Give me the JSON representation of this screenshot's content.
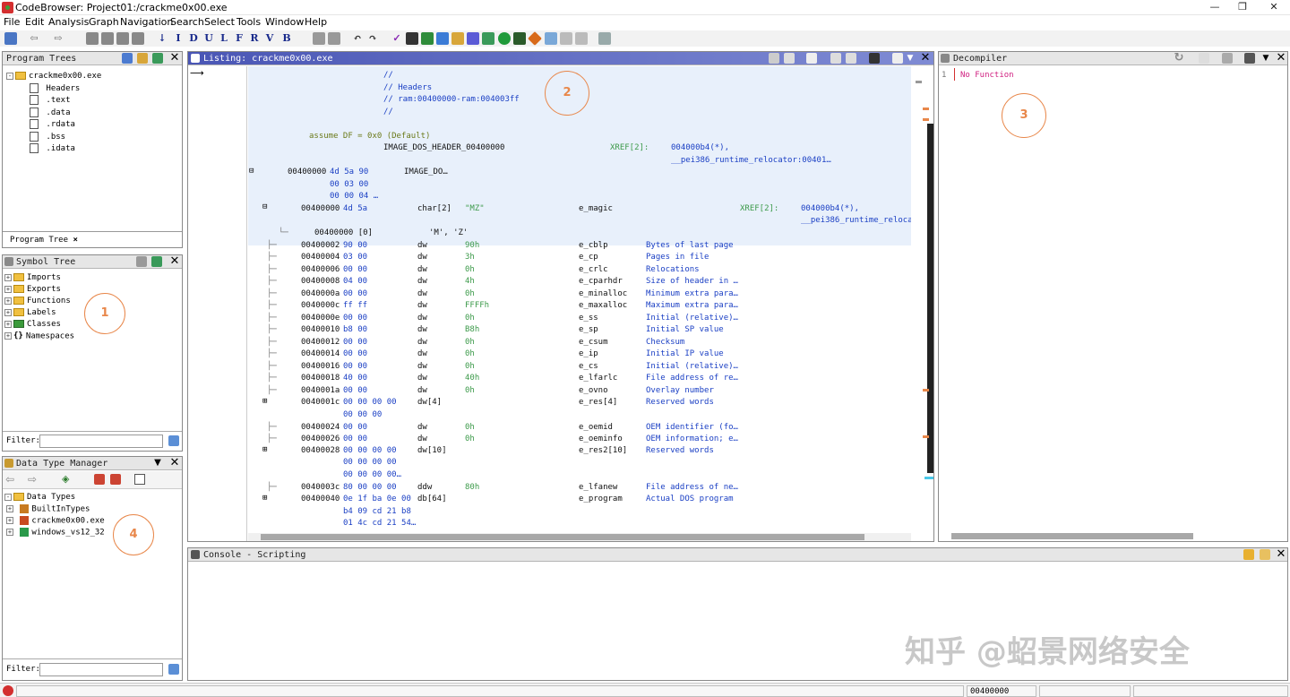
{
  "window": {
    "title": "CodeBrowser: Project01:/crackme0x00.exe"
  },
  "menu": [
    "File",
    "Edit",
    "Analysis",
    "Graph",
    "Navigation",
    "Search",
    "Select",
    "Tools",
    "Window",
    "Help"
  ],
  "program_trees": {
    "title": "Program Trees",
    "root": "crackme0x00.exe",
    "items": [
      "Headers",
      ".text",
      ".data",
      ".rdata",
      ".bss",
      ".idata"
    ],
    "tab": "Program Tree"
  },
  "symbol_tree": {
    "title": "Symbol Tree",
    "items": [
      "Imports",
      "Exports",
      "Functions",
      "Labels",
      "Classes",
      "Namespaces"
    ],
    "filter_label": "Filter:"
  },
  "dtm": {
    "title": "Data Type Manager",
    "root": "Data Types",
    "items": [
      "BuiltInTypes",
      "crackme0x00.exe",
      "windows_vs12_32"
    ],
    "filter_label": "Filter:"
  },
  "listing": {
    "title": "Listing:  crackme0x00.exe",
    "comments": [
      "//",
      "// Headers",
      "// ram:00400000-ram:004003ff",
      "//"
    ],
    "assume": "assume DF = 0x0  (Default)",
    "header_label": "IMAGE_DOS_HEADER_00400000",
    "header_xref_label": "XREF[2]:",
    "header_xref1": "004000b4(*),",
    "header_xref2": "__pei386_runtime_relocator:00401…",
    "struct_addr": "00400000",
    "struct_bytes": "4d 5a 90",
    "struct_bytes2": "00 03 00",
    "struct_bytes3": "00 00 04 …",
    "struct_name": "IMAGE_DO…",
    "magic": {
      "addr": "00400000",
      "bytes": "4d 5a",
      "type": "char[2]",
      "val": "\"MZ\"",
      "field": "e_magic",
      "xref_label": "XREF[2]:",
      "xref1": "004000b4(*),",
      "xref2": "__pei386_runtime_relocat"
    },
    "magic_sub": {
      "addr": "00400000 [0]",
      "val": "'M', 'Z'"
    },
    "rows": [
      {
        "addr": "00400002",
        "bytes": "90 00",
        "mn": "dw",
        "val": "90h",
        "field": "e_cblp",
        "cmt": "Bytes of last page"
      },
      {
        "addr": "00400004",
        "bytes": "03 00",
        "mn": "dw",
        "val": "3h",
        "field": "e_cp",
        "cmt": "Pages in file"
      },
      {
        "addr": "00400006",
        "bytes": "00 00",
        "mn": "dw",
        "val": "0h",
        "field": "e_crlc",
        "cmt": "Relocations"
      },
      {
        "addr": "00400008",
        "bytes": "04 00",
        "mn": "dw",
        "val": "4h",
        "field": "e_cparhdr",
        "cmt": "Size of header in …"
      },
      {
        "addr": "0040000a",
        "bytes": "00 00",
        "mn": "dw",
        "val": "0h",
        "field": "e_minalloc",
        "cmt": "Minimum extra para…"
      },
      {
        "addr": "0040000c",
        "bytes": "ff ff",
        "mn": "dw",
        "val": "FFFFh",
        "field": "e_maxalloc",
        "cmt": "Maximum extra para…"
      },
      {
        "addr": "0040000e",
        "bytes": "00 00",
        "mn": "dw",
        "val": "0h",
        "field": "e_ss",
        "cmt": "Initial (relative)…"
      },
      {
        "addr": "00400010",
        "bytes": "b8 00",
        "mn": "dw",
        "val": "B8h",
        "field": "e_sp",
        "cmt": "Initial SP value"
      },
      {
        "addr": "00400012",
        "bytes": "00 00",
        "mn": "dw",
        "val": "0h",
        "field": "e_csum",
        "cmt": "Checksum"
      },
      {
        "addr": "00400014",
        "bytes": "00 00",
        "mn": "dw",
        "val": "0h",
        "field": "e_ip",
        "cmt": "Initial IP value"
      },
      {
        "addr": "00400016",
        "bytes": "00 00",
        "mn": "dw",
        "val": "0h",
        "field": "e_cs",
        "cmt": "Initial (relative)…"
      },
      {
        "addr": "00400018",
        "bytes": "40 00",
        "mn": "dw",
        "val": "40h",
        "field": "e_lfarlc",
        "cmt": "File address of re…"
      },
      {
        "addr": "0040001a",
        "bytes": "00 00",
        "mn": "dw",
        "val": "0h",
        "field": "e_ovno",
        "cmt": "Overlay number"
      }
    ],
    "res": {
      "addr": "0040001c",
      "bytes": "00 00 00 00",
      "bytes2": "00 00 00",
      "mn": "dw[4]",
      "field": "e_res[4]",
      "cmt": "Reserved words"
    },
    "rows2": [
      {
        "addr": "00400024",
        "bytes": "00 00",
        "mn": "dw",
        "val": "0h",
        "field": "e_oemid",
        "cmt": "OEM identifier (fo…"
      },
      {
        "addr": "00400026",
        "bytes": "00 00",
        "mn": "dw",
        "val": "0h",
        "field": "e_oeminfo",
        "cmt": "OEM information; e…"
      }
    ],
    "res2": {
      "addr": "00400028",
      "bytes": "00 00 00 00",
      "bytes2": "00 00 00 00",
      "bytes3": "00 00 00 00…",
      "mn": "dw[10]",
      "field": "e_res2[10]",
      "cmt": "Reserved words"
    },
    "lfanew": {
      "addr": "0040003c",
      "bytes": "80 00 00 00",
      "mn": "ddw",
      "val": "80h",
      "field": "e_lfanew",
      "cmt": "File address of ne…"
    },
    "program": {
      "addr": "00400040",
      "bytes": "0e 1f ba 0e 00",
      "bytes2": "b4 09 cd 21 b8",
      "bytes3": "01 4c cd 21 54…",
      "mn": "db[64]",
      "field": "e_program",
      "cmt": "Actual DOS program"
    }
  },
  "decompiler": {
    "title": "Decompiler",
    "line_no": "1",
    "text": "No Function"
  },
  "console": {
    "title": "Console - Scripting"
  },
  "status": {
    "address": "00400000"
  },
  "annotations": [
    "1",
    "2",
    "3",
    "4"
  ],
  "watermark": "知乎 @蛁景网络安全",
  "colors": {
    "accent": "#4a56b5",
    "annotation": "#e8874a",
    "listing_bg": "#e8f0fb",
    "xref": "#3c9a4a",
    "comment": "#1a3fc4"
  }
}
